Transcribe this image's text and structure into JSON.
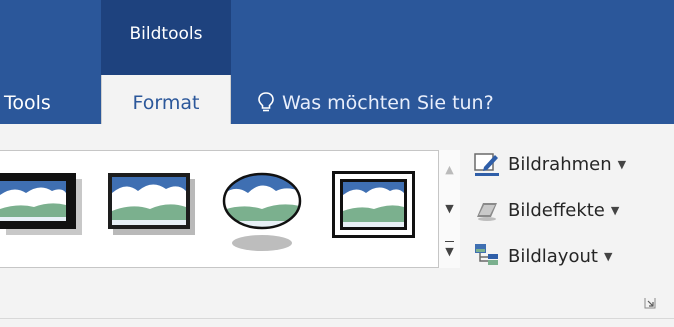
{
  "ribbon": {
    "context_group": "Bildtools",
    "tabs": [
      {
        "label": "Tools",
        "active": false
      },
      {
        "label": "Format",
        "active": true
      }
    ],
    "tell_me": "Was möchten Sie tun?"
  },
  "picture_styles": {
    "gallery_items": [
      {
        "style": "thick-black-frame-shadow",
        "active": false
      },
      {
        "style": "blue-frame-shadow",
        "active": false
      },
      {
        "style": "oval-reflected",
        "active": false
      },
      {
        "style": "double-frame-black",
        "active": true
      }
    ],
    "commands": [
      {
        "label": "Bildrahmen",
        "icon": "picture-border-icon"
      },
      {
        "label": "Bildeffekte",
        "icon": "picture-effects-icon"
      },
      {
        "label": "Bildlayout",
        "icon": "picture-layout-icon"
      }
    ]
  },
  "colors": {
    "title_bar": "#2b579a",
    "context_tab": "#1e427e",
    "ribbon_bg": "#f3f3f3",
    "accent_text": "#2b579a"
  }
}
